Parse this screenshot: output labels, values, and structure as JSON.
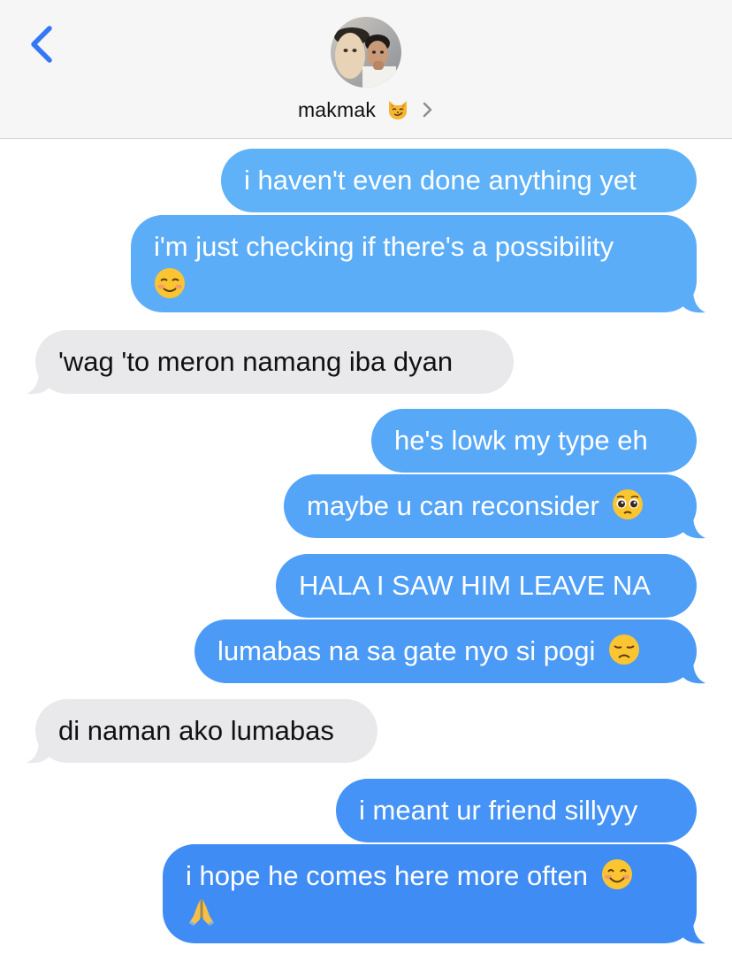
{
  "header": {
    "contact_name": "makmak",
    "contact_emoji": "smirking-cat-icon",
    "back_icon": "chevron-left-icon",
    "disclosure_icon": "chevron-right-icon",
    "accent_color": "#3478f6"
  },
  "messages": [
    {
      "from": "me",
      "text": "i haven't even done anything yet"
    },
    {
      "from": "me",
      "text": "i'm just checking if there's a possibility",
      "emoji": "smiling-face-icon"
    },
    {
      "from": "them",
      "text": "'wag 'to meron namang iba dyan"
    },
    {
      "from": "me",
      "text": "he's lowk my type eh"
    },
    {
      "from": "me",
      "text": "maybe u can reconsider",
      "emoji": "pleading-face-icon"
    },
    {
      "from": "me",
      "text": "HALA I SAW HIM LEAVE NA"
    },
    {
      "from": "me",
      "text": "lumabas na sa gate nyo si pogi",
      "emoji": "disappointed-face-icon"
    },
    {
      "from": "them",
      "text": "di naman ako lumabas"
    },
    {
      "from": "me",
      "text": "i meant ur friend sillyyy"
    },
    {
      "from": "me",
      "text": "i hope he comes here more often",
      "emoji": "smiling-blush-face-icon",
      "emoji2": "folded-hands-icon"
    }
  ],
  "colors": {
    "sent_top": "#5eb1f8",
    "sent_bottom": "#3f89f5",
    "received": "#e9e9eb"
  }
}
